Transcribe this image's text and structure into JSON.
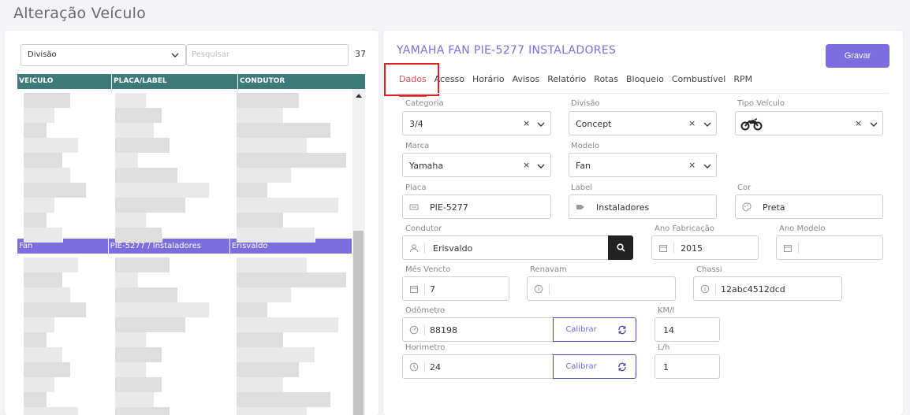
{
  "page": {
    "title": "Alteração Veículo"
  },
  "left": {
    "division_select": "Divisão",
    "search_placeholder": "Pesquisar",
    "count": "37",
    "columns": [
      "VEICULO",
      "PLACA/LABEL",
      "CONDUTOR"
    ],
    "selected_row": {
      "veiculo": "Fan",
      "placa": "PIE-5277 / Instaladores",
      "condutor": "Erisvaldo"
    }
  },
  "right": {
    "title": "YAMAHA FAN PIE-5277 INSTALADORES",
    "save_label": "Gravar",
    "tabs": [
      "Dados",
      "Acesso",
      "Horário",
      "Avisos",
      "Relatório",
      "Rotas",
      "Bloqueio",
      "Combustível",
      "RPM"
    ],
    "form": {
      "categoria": {
        "label": "Categoria",
        "value": "3/4"
      },
      "divisao": {
        "label": "Divisão",
        "value": "Concept"
      },
      "tipo_veiculo": {
        "label": "Tipo Veículo",
        "icon": "motorcycle-icon"
      },
      "marca": {
        "label": "Marca",
        "value": "Yamaha"
      },
      "modelo": {
        "label": "Modelo",
        "value": "Fan"
      },
      "placa": {
        "label": "Placa",
        "value": "PIE-5277"
      },
      "label": {
        "label": "Label",
        "value": "Instaladores"
      },
      "cor": {
        "label": "Cor",
        "value": "Preta"
      },
      "condutor": {
        "label": "Condutor",
        "value": "Erisvaldo"
      },
      "ano_fabricacao": {
        "label": "Ano Fabricação",
        "value": "2015"
      },
      "ano_modelo": {
        "label": "Ano Modelo",
        "value": ""
      },
      "mes_vencto": {
        "label": "Mês Vencto",
        "value": "7"
      },
      "renavam": {
        "label": "Renavam",
        "value": ""
      },
      "chassi": {
        "label": "Chassi",
        "value": "12abc4512dcd"
      },
      "odometro": {
        "label": "Odômetro",
        "value": "88198"
      },
      "km_l": {
        "label": "KM/l",
        "value": "14"
      },
      "horimetro": {
        "label": "Horimetro",
        "value": "24"
      },
      "l_h": {
        "label": "L/h",
        "value": "1"
      },
      "calibrar_label": "Calibrar",
      "clear_symbol": "×"
    }
  },
  "colors": {
    "accent": "#7c6ee0",
    "grid_header": "#3e7a7a",
    "active_tab": "#e74c4c"
  }
}
